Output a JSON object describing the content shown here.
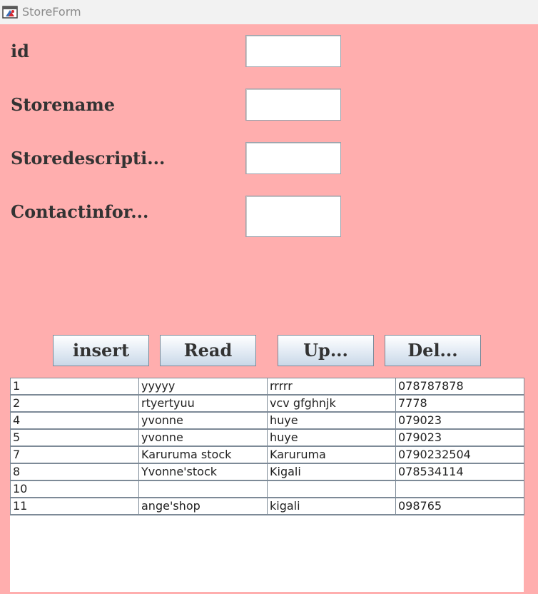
{
  "window": {
    "title": "StoreForm",
    "icon": "java-app-icon"
  },
  "form": {
    "fields": [
      {
        "label": "id",
        "value": ""
      },
      {
        "label": "Storename",
        "value": ""
      },
      {
        "label": "Storedescripti...",
        "value": ""
      },
      {
        "label": "Contactinfor...",
        "value": ""
      }
    ]
  },
  "buttons": {
    "insert": "insert",
    "read": "Read",
    "update": "Up...",
    "delete": "Del..."
  },
  "table": {
    "rows": [
      [
        "1",
        "yyyyy",
        "rrrrr",
        "078787878"
      ],
      [
        "2",
        "rtyertyuu",
        "vcv gfghnjk",
        "7778"
      ],
      [
        "4",
        "yvonne",
        "huye",
        "079023"
      ],
      [
        "5",
        "yvonne",
        "huye",
        "079023"
      ],
      [
        "7",
        "Karuruma stock",
        "Karuruma",
        "0790232504"
      ],
      [
        "8",
        "Yvonne'stock",
        "Kigali",
        "078534114"
      ],
      [
        "10",
        "",
        "",
        ""
      ],
      [
        "11",
        "ange'shop",
        "kigali",
        "098765"
      ]
    ]
  },
  "colors": {
    "background": "#ffaeae",
    "titlebar": "#f2f2f2",
    "label_text": "#333333",
    "grid": "#7d8a97"
  }
}
